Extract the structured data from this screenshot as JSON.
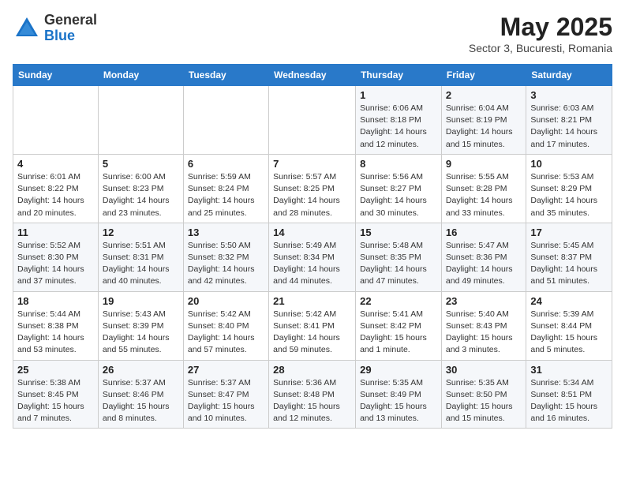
{
  "header": {
    "logo_general": "General",
    "logo_blue": "Blue",
    "month": "May 2025",
    "location": "Sector 3, Bucuresti, Romania"
  },
  "day_headers": [
    "Sunday",
    "Monday",
    "Tuesday",
    "Wednesday",
    "Thursday",
    "Friday",
    "Saturday"
  ],
  "weeks": [
    [
      {
        "day": "",
        "text": ""
      },
      {
        "day": "",
        "text": ""
      },
      {
        "day": "",
        "text": ""
      },
      {
        "day": "",
        "text": ""
      },
      {
        "day": "1",
        "text": "Sunrise: 6:06 AM\nSunset: 8:18 PM\nDaylight: 14 hours and 12 minutes."
      },
      {
        "day": "2",
        "text": "Sunrise: 6:04 AM\nSunset: 8:19 PM\nDaylight: 14 hours and 15 minutes."
      },
      {
        "day": "3",
        "text": "Sunrise: 6:03 AM\nSunset: 8:21 PM\nDaylight: 14 hours and 17 minutes."
      }
    ],
    [
      {
        "day": "4",
        "text": "Sunrise: 6:01 AM\nSunset: 8:22 PM\nDaylight: 14 hours and 20 minutes."
      },
      {
        "day": "5",
        "text": "Sunrise: 6:00 AM\nSunset: 8:23 PM\nDaylight: 14 hours and 23 minutes."
      },
      {
        "day": "6",
        "text": "Sunrise: 5:59 AM\nSunset: 8:24 PM\nDaylight: 14 hours and 25 minutes."
      },
      {
        "day": "7",
        "text": "Sunrise: 5:57 AM\nSunset: 8:25 PM\nDaylight: 14 hours and 28 minutes."
      },
      {
        "day": "8",
        "text": "Sunrise: 5:56 AM\nSunset: 8:27 PM\nDaylight: 14 hours and 30 minutes."
      },
      {
        "day": "9",
        "text": "Sunrise: 5:55 AM\nSunset: 8:28 PM\nDaylight: 14 hours and 33 minutes."
      },
      {
        "day": "10",
        "text": "Sunrise: 5:53 AM\nSunset: 8:29 PM\nDaylight: 14 hours and 35 minutes."
      }
    ],
    [
      {
        "day": "11",
        "text": "Sunrise: 5:52 AM\nSunset: 8:30 PM\nDaylight: 14 hours and 37 minutes."
      },
      {
        "day": "12",
        "text": "Sunrise: 5:51 AM\nSunset: 8:31 PM\nDaylight: 14 hours and 40 minutes."
      },
      {
        "day": "13",
        "text": "Sunrise: 5:50 AM\nSunset: 8:32 PM\nDaylight: 14 hours and 42 minutes."
      },
      {
        "day": "14",
        "text": "Sunrise: 5:49 AM\nSunset: 8:34 PM\nDaylight: 14 hours and 44 minutes."
      },
      {
        "day": "15",
        "text": "Sunrise: 5:48 AM\nSunset: 8:35 PM\nDaylight: 14 hours and 47 minutes."
      },
      {
        "day": "16",
        "text": "Sunrise: 5:47 AM\nSunset: 8:36 PM\nDaylight: 14 hours and 49 minutes."
      },
      {
        "day": "17",
        "text": "Sunrise: 5:45 AM\nSunset: 8:37 PM\nDaylight: 14 hours and 51 minutes."
      }
    ],
    [
      {
        "day": "18",
        "text": "Sunrise: 5:44 AM\nSunset: 8:38 PM\nDaylight: 14 hours and 53 minutes."
      },
      {
        "day": "19",
        "text": "Sunrise: 5:43 AM\nSunset: 8:39 PM\nDaylight: 14 hours and 55 minutes."
      },
      {
        "day": "20",
        "text": "Sunrise: 5:42 AM\nSunset: 8:40 PM\nDaylight: 14 hours and 57 minutes."
      },
      {
        "day": "21",
        "text": "Sunrise: 5:42 AM\nSunset: 8:41 PM\nDaylight: 14 hours and 59 minutes."
      },
      {
        "day": "22",
        "text": "Sunrise: 5:41 AM\nSunset: 8:42 PM\nDaylight: 15 hours and 1 minute."
      },
      {
        "day": "23",
        "text": "Sunrise: 5:40 AM\nSunset: 8:43 PM\nDaylight: 15 hours and 3 minutes."
      },
      {
        "day": "24",
        "text": "Sunrise: 5:39 AM\nSunset: 8:44 PM\nDaylight: 15 hours and 5 minutes."
      }
    ],
    [
      {
        "day": "25",
        "text": "Sunrise: 5:38 AM\nSunset: 8:45 PM\nDaylight: 15 hours and 7 minutes."
      },
      {
        "day": "26",
        "text": "Sunrise: 5:37 AM\nSunset: 8:46 PM\nDaylight: 15 hours and 8 minutes."
      },
      {
        "day": "27",
        "text": "Sunrise: 5:37 AM\nSunset: 8:47 PM\nDaylight: 15 hours and 10 minutes."
      },
      {
        "day": "28",
        "text": "Sunrise: 5:36 AM\nSunset: 8:48 PM\nDaylight: 15 hours and 12 minutes."
      },
      {
        "day": "29",
        "text": "Sunrise: 5:35 AM\nSunset: 8:49 PM\nDaylight: 15 hours and 13 minutes."
      },
      {
        "day": "30",
        "text": "Sunrise: 5:35 AM\nSunset: 8:50 PM\nDaylight: 15 hours and 15 minutes."
      },
      {
        "day": "31",
        "text": "Sunrise: 5:34 AM\nSunset: 8:51 PM\nDaylight: 15 hours and 16 minutes."
      }
    ]
  ]
}
